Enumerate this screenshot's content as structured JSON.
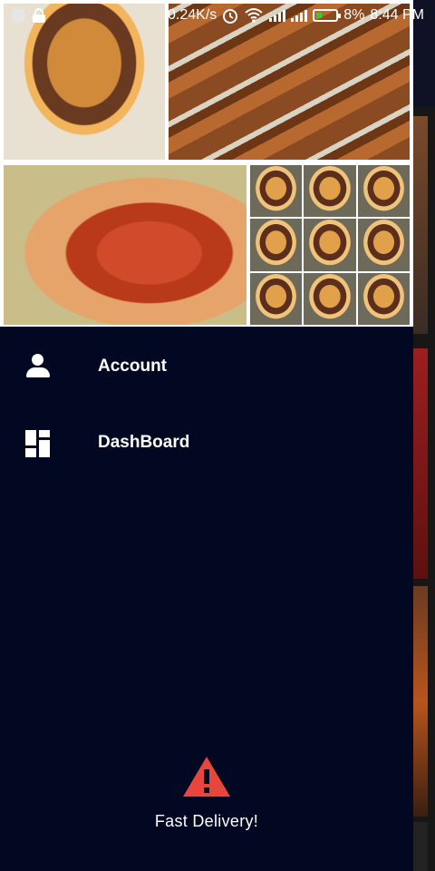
{
  "status_bar": {
    "network_speed": "0.24K/s",
    "battery": "8%",
    "time": "8:44 PM",
    "icons": [
      "notification-dot-icon",
      "lock-icon",
      "alarm-icon",
      "wifi-icon",
      "signal-icon",
      "signal-icon",
      "battery-icon"
    ]
  },
  "drawer": {
    "header_images": [
      "burger-photo",
      "kebab-photo",
      "hotdog-photo",
      "burger-collage"
    ],
    "menu": [
      {
        "label": "Account",
        "icon": "person-icon"
      },
      {
        "label": "DashBoard",
        "icon": "dashboard-icon"
      }
    ],
    "footer": {
      "label": "Fast Delivery!",
      "icon": "warning-icon",
      "icon_color": "#e8453c"
    }
  },
  "colors": {
    "drawer_bg": "#030822",
    "text": "#ffffff"
  }
}
